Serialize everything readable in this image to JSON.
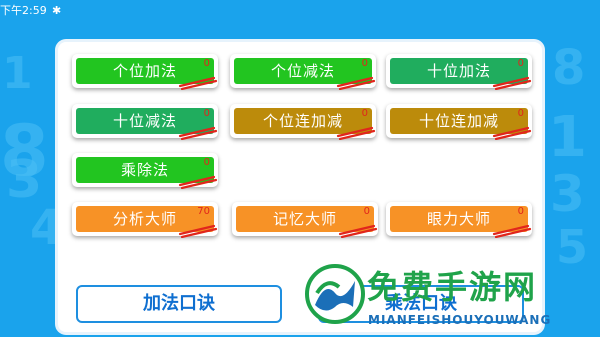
{
  "status_bar": {
    "time": "下午2:59",
    "bluetooth_icon": "bluetooth-icon"
  },
  "background": {
    "digits": [
      "1",
      "8",
      "3",
      "4",
      "8",
      "1",
      "3",
      "5",
      "0",
      "2"
    ]
  },
  "colors": {
    "green": "#22c520",
    "teal": "#20ad5e",
    "olive": "#bc8b0b",
    "orange": "#f79226",
    "score": "#e1261c",
    "accent": "#1aa3ec"
  },
  "buttons": [
    {
      "label": "个位加法",
      "score": "0"
    },
    {
      "label": "个位减法",
      "score": "0"
    },
    {
      "label": "十位加法",
      "score": "0"
    },
    {
      "label": "十位减法",
      "score": "0"
    },
    {
      "label": "个位连加减",
      "score": "0"
    },
    {
      "label": "十位连加减",
      "score": "0"
    },
    {
      "label": "乘除法",
      "score": "0"
    },
    {
      "label": "分析大师",
      "score": "70"
    },
    {
      "label": "记忆大师",
      "score": "0"
    },
    {
      "label": "眼力大师",
      "score": "0"
    }
  ],
  "bottom": {
    "addition_rhyme": "加法口诀",
    "multiplication_rhyme": "乘法口诀"
  },
  "watermark": {
    "title": "免费手游网",
    "subtitle": "MIANFEISHOUYOUWANG"
  }
}
